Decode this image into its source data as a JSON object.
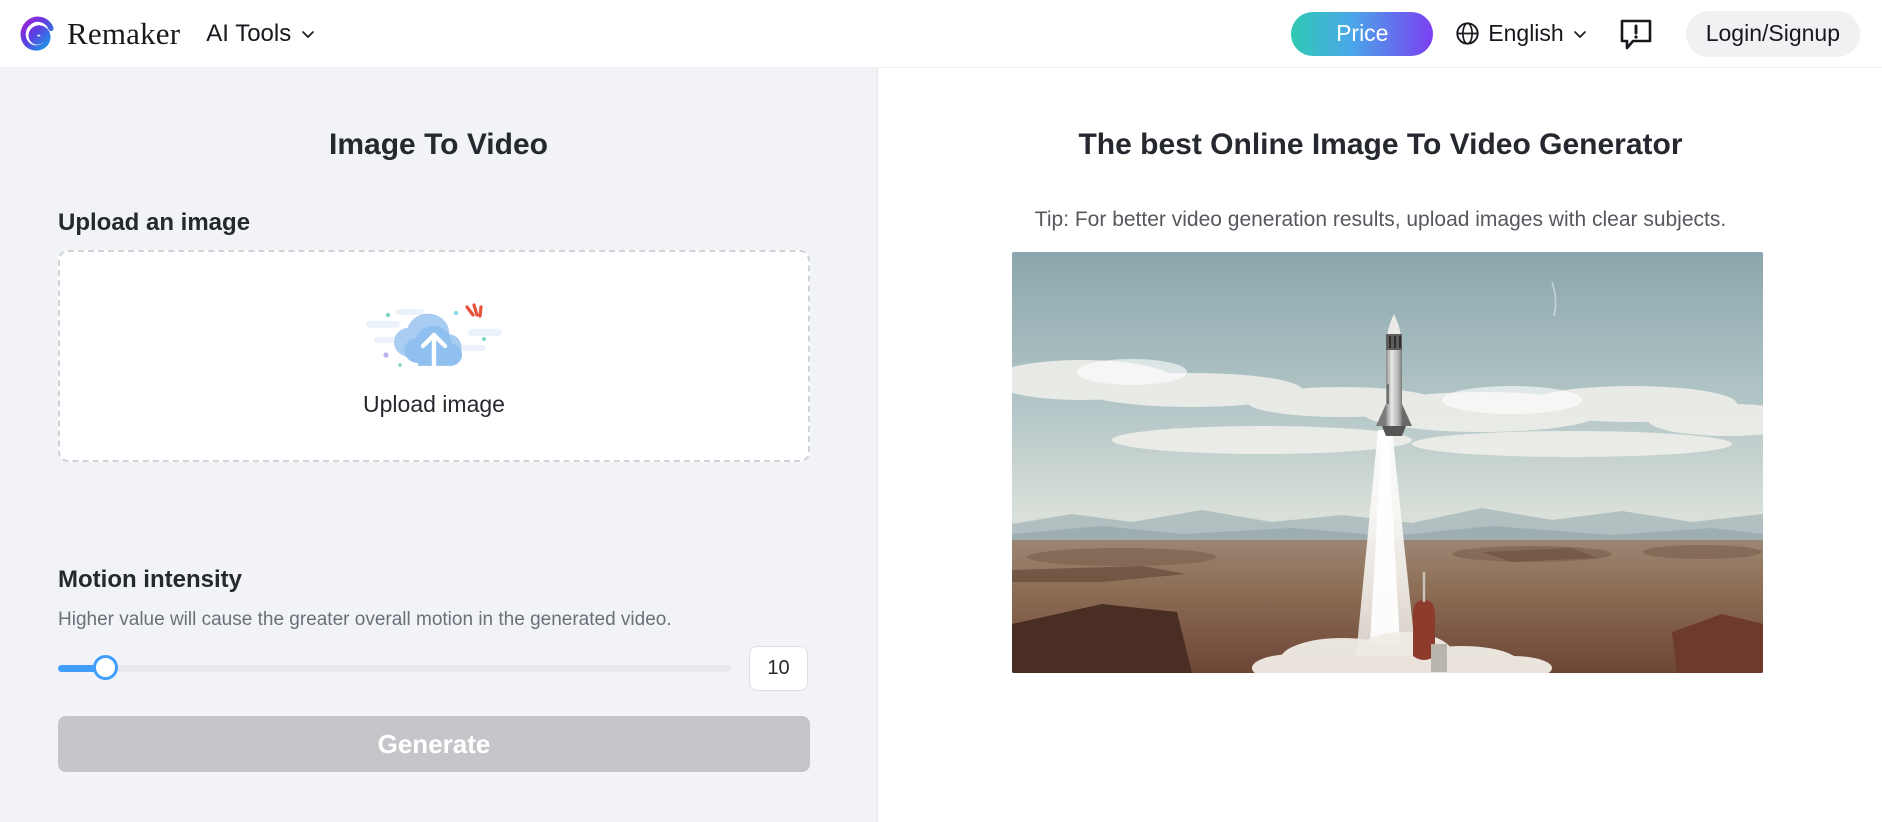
{
  "header": {
    "brand_name": "Remaker",
    "nav": {
      "tools_label": "AI Tools",
      "chevron_icon": "chevron-down-icon"
    },
    "price_label": "Price",
    "language": {
      "label": "English",
      "globe_icon": "globe-icon",
      "chevron_icon": "chevron-down-icon"
    },
    "feedback_icon": "feedback-bubble-icon",
    "login_label": "Login/Signup",
    "logo_icon": "remaker-spiral-logo"
  },
  "left_panel": {
    "title": "Image To Video",
    "upload_section_label": "Upload an image",
    "dropzone": {
      "text": "Upload image",
      "icon": "cloud-upload-icon"
    },
    "motion": {
      "label": "Motion intensity",
      "description": "Higher value will cause the greater overall motion in the generated video.",
      "value": "10",
      "min": 1,
      "max": 127,
      "fill_percent": 7
    },
    "generate_label": "Generate",
    "generate_disabled": true
  },
  "right_panel": {
    "title": "The best Online Image To Video Generator",
    "tip": "Tip: For better video generation results, upload images with clear subjects.",
    "preview_alt": "rocket-launch-over-desert"
  },
  "colors": {
    "accent_blue": "#409eff",
    "price_gradient_start": "#2fc9b4",
    "price_gradient_end": "#7b3ff2",
    "panel_bg": "#f1f3f7",
    "disabled_button": "#c4c6c9"
  }
}
